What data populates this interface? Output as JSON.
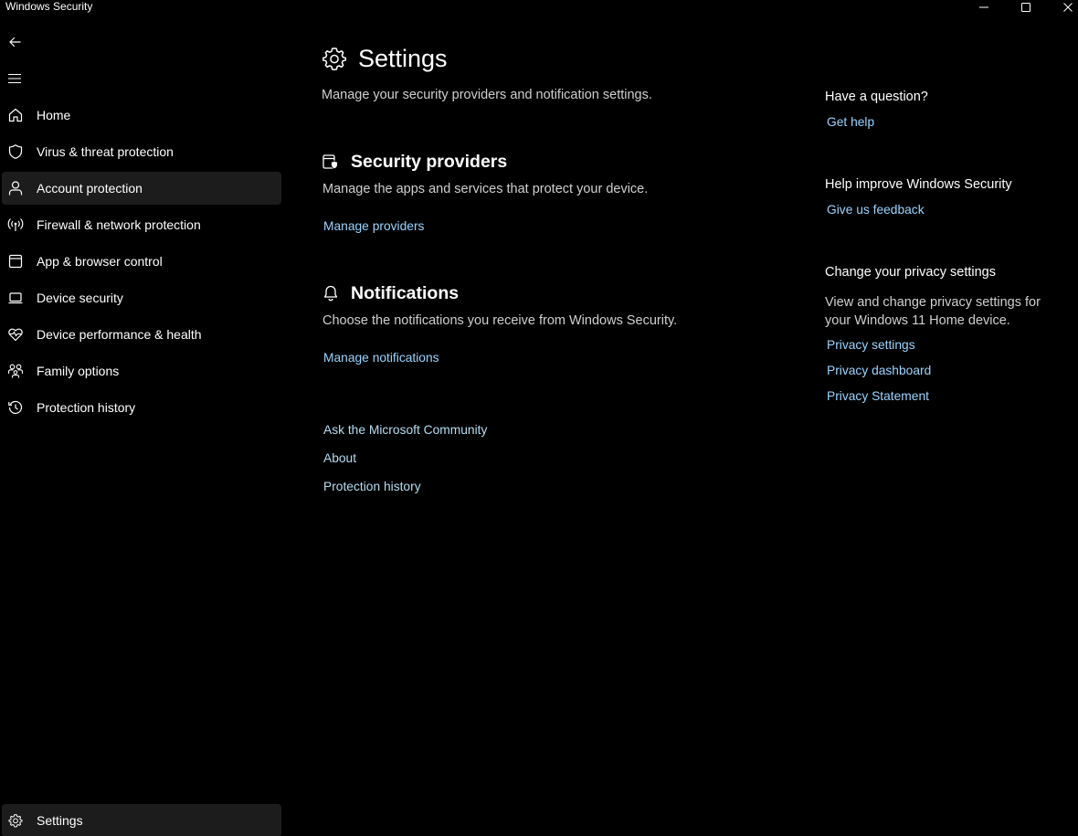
{
  "window": {
    "title": "Windows Security"
  },
  "sidebar": {
    "items": [
      {
        "label": "Home",
        "icon": "home-icon"
      },
      {
        "label": "Virus & threat protection",
        "icon": "shield-icon"
      },
      {
        "label": "Account protection",
        "icon": "person-icon"
      },
      {
        "label": "Firewall & network protection",
        "icon": "antenna-icon"
      },
      {
        "label": "App & browser control",
        "icon": "app-window-icon"
      },
      {
        "label": "Device security",
        "icon": "laptop-icon"
      },
      {
        "label": "Device performance & health",
        "icon": "heart-pulse-icon"
      },
      {
        "label": "Family options",
        "icon": "family-icon"
      },
      {
        "label": "Protection history",
        "icon": "history-icon"
      }
    ],
    "selected": "Account protection",
    "bottom_item": {
      "label": "Settings",
      "icon": "gear-icon"
    }
  },
  "main": {
    "title": "Settings",
    "description": "Manage your security providers and notification settings.",
    "security_providers": {
      "title": "Security providers",
      "description": "Manage the apps and services that protect your device.",
      "link": "Manage providers"
    },
    "notifications": {
      "title": "Notifications",
      "description": "Choose the notifications you receive from Windows Security.",
      "link": "Manage notifications"
    },
    "links": {
      "community": "Ask the Microsoft Community",
      "about": "About",
      "history": "Protection history"
    }
  },
  "aside": {
    "question": {
      "title": "Have a question?",
      "link": "Get help"
    },
    "improve": {
      "title": "Help improve Windows Security",
      "link": "Give us feedback"
    },
    "privacy": {
      "title": "Change your privacy settings",
      "text": "View and change privacy settings for your Windows 11 Home device.",
      "links": [
        "Privacy settings",
        "Privacy dashboard",
        "Privacy Statement"
      ]
    }
  },
  "colors": {
    "background": "#000000",
    "link": "#9ad4ff",
    "selected": "#1c1c1c"
  }
}
